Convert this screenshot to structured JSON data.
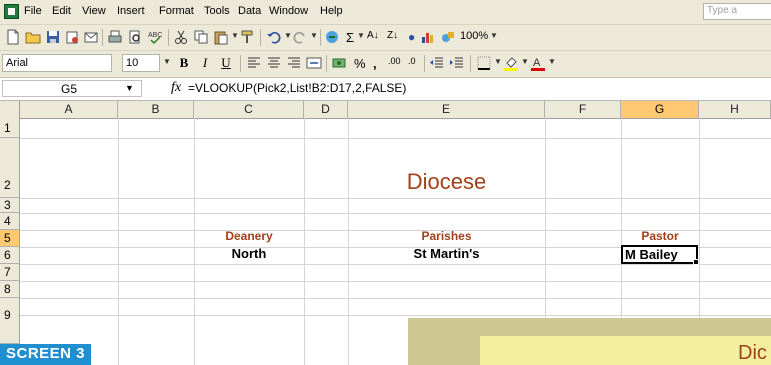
{
  "menu": {
    "items": [
      "File",
      "Edit",
      "View",
      "Insert",
      "Format",
      "Tools",
      "Data",
      "Window",
      "Help"
    ],
    "ask_placeholder": "Type a"
  },
  "toolbar_standard": {
    "zoom": "100%"
  },
  "toolbar_formatting": {
    "font": "Arial",
    "size": "10",
    "bold": "B",
    "italic": "I",
    "underline": "U",
    "percent": "%",
    "comma": ","
  },
  "formula_bar": {
    "cell_ref": "G5",
    "fx": "fx",
    "formula": "=VLOOKUP(Pick2,List!B2:D17,2,FALSE)"
  },
  "grid": {
    "columns": [
      "A",
      "B",
      "C",
      "D",
      "E",
      "F",
      "G",
      "H"
    ],
    "rows": [
      "1",
      "2",
      "3",
      "4",
      "5",
      "6",
      "7",
      "8",
      "9"
    ],
    "selected_column": "G",
    "selected_row": "5",
    "title": "Diocese",
    "headers": {
      "deanery": "Deanery",
      "parishes": "Parishes",
      "pastor": "Pastor"
    },
    "values": {
      "deanery": "North",
      "parishes": "St Martin's",
      "pastor": "M Bailey"
    }
  },
  "overlay": {
    "title_fragment": "Dic"
  },
  "caption": "SCREEN 3",
  "colors": {
    "heading": "#a2401a",
    "chrome": "#ece9d8",
    "selection_header": "#ffc873",
    "caption_bg": "#1f8fcf"
  }
}
